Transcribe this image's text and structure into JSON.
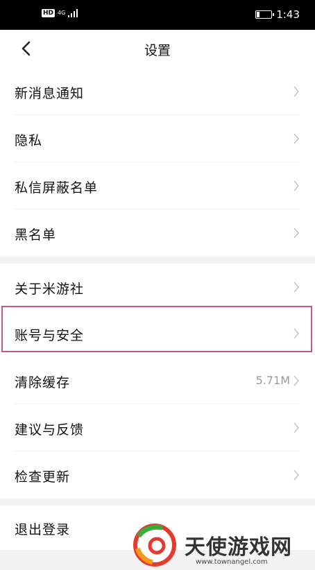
{
  "status_bar": {
    "network_badge": "HD",
    "network_type": "4G",
    "time": "1:43"
  },
  "header": {
    "title": "设置"
  },
  "group1": [
    {
      "label": "新消息通知"
    },
    {
      "label": "隐私"
    },
    {
      "label": "私信屏蔽名单"
    },
    {
      "label": "黑名单"
    }
  ],
  "group2": [
    {
      "label": "关于米游社"
    },
    {
      "label": "账号与安全",
      "highlighted": true
    },
    {
      "label": "清除缓存",
      "value": "5.71M"
    },
    {
      "label": "建议与反馈"
    },
    {
      "label": "检查更新"
    }
  ],
  "logout": {
    "label": "退出登录"
  },
  "watermark": {
    "text": "天使游戏网",
    "url": "www.townangel.com"
  },
  "colors": {
    "highlight_border": "#c0578f",
    "section_gap": "#f2f2f2"
  }
}
